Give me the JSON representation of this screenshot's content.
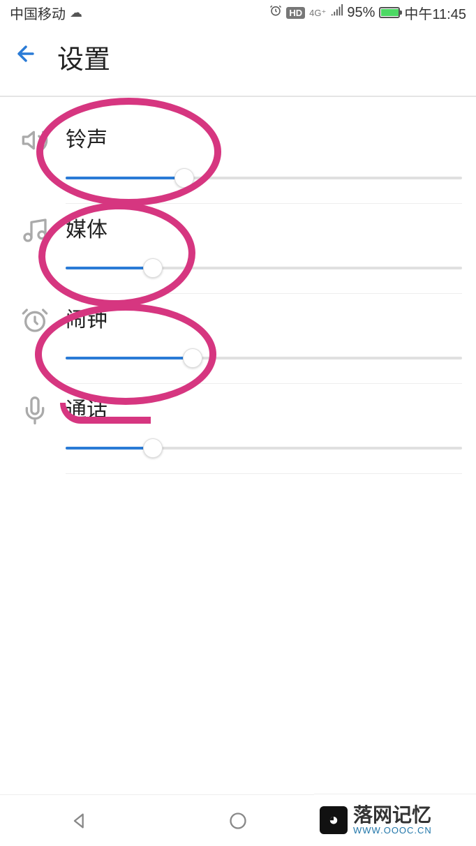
{
  "status_bar": {
    "carrier": "中国移动",
    "hd_label": "HD",
    "network_label": "4G⁺",
    "battery_percent": "95%",
    "time": "中午11:45"
  },
  "header": {
    "title": "设置"
  },
  "sliders": [
    {
      "icon": "speaker-icon",
      "label": "铃声",
      "value": 30
    },
    {
      "icon": "music-icon",
      "label": "媒体",
      "value": 22
    },
    {
      "icon": "alarm-icon",
      "label": "闹钟",
      "value": 32
    },
    {
      "icon": "microphone-icon",
      "label": "通话",
      "value": 22
    }
  ],
  "watermark": {
    "title": "落网记忆",
    "url": "WWW.OOOC.CN"
  }
}
